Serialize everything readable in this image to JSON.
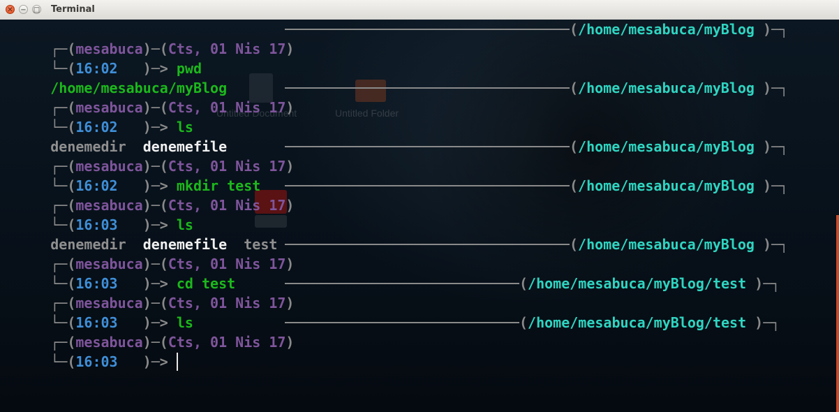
{
  "window": {
    "title": "Terminal"
  },
  "prompt": {
    "user": "mesabuca",
    "date": "Cts, 01 Nis 17"
  },
  "desktop_ghosts": {
    "doc_label": "Untitled Document",
    "folder_label": "Untitled Folder"
  },
  "colors": {
    "user": "#7f559c",
    "time": "#3f8fd8",
    "command": "#1cb81c",
    "path": "#2fd5c1",
    "frame": "#8a8a8a",
    "dir": "#8f8f8f",
    "file": "#f0f0f0"
  },
  "blocks": [
    {
      "path": "/home/mesabuca/myBlog",
      "time": "16:02",
      "command": "pwd"
    },
    {
      "path": "/home/mesabuca/myBlog",
      "time": "16:02",
      "command": "ls"
    },
    {
      "path": "/home/mesabuca/myBlog",
      "time": "16:02",
      "command": "mkdir test"
    },
    {
      "path": "/home/mesabuca/myBlog",
      "time": "16:03",
      "command": "ls"
    },
    {
      "path": "/home/mesabuca/myBlog",
      "time": "16:03",
      "command": "cd test"
    },
    {
      "path": "/home/mesabuca/myBlog/test",
      "time": "16:03",
      "command": "ls"
    },
    {
      "path": "/home/mesabuca/myBlog/test",
      "time": "16:03",
      "command": ""
    }
  ],
  "outputs": {
    "pwd": "/home/mesabuca/myBlog",
    "ls1": {
      "dir": "denemedir",
      "file": "denemefile"
    },
    "ls2": {
      "dir": "denemedir",
      "file": "denemefile",
      "dir2": "test"
    }
  }
}
